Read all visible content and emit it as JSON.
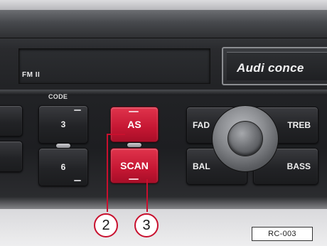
{
  "display": {
    "band": "FM II"
  },
  "brand": {
    "text": "Audi conce"
  },
  "code": {
    "label": "CODE",
    "upper_key": "3",
    "lower_key": "6"
  },
  "buttons": {
    "as_label": "AS",
    "scan_label": "SCAN",
    "fad_label": "FAD",
    "treb_label": "TREB",
    "bal_label": "BAL",
    "bass_label": "BASS"
  },
  "callouts": {
    "as": "2",
    "scan": "3"
  },
  "figure_ref": "RC-003",
  "colors": {
    "highlight_red": "#c51733",
    "callout_red": "#c8102e"
  }
}
